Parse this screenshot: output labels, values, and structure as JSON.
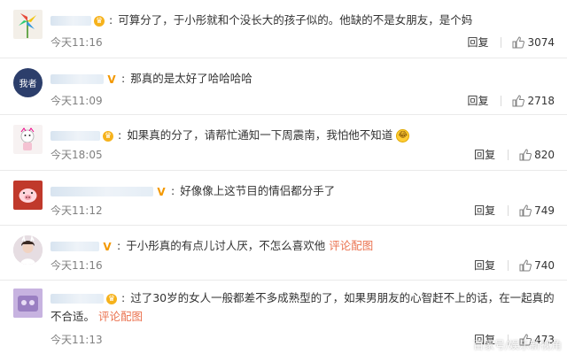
{
  "comments": [
    {
      "text": "可算分了，于小彤就和个没长大的孩子似的。他缺的不是女朋友，是个妈",
      "time": "今天11:16",
      "reply_label": "回复",
      "likes": "3074",
      "badge": "crown"
    },
    {
      "text": "那真的是太好了哈哈哈哈",
      "time": "今天11:09",
      "reply_label": "回复",
      "likes": "2718",
      "badge": "vip"
    },
    {
      "text": "如果真的分了，请帮忙通知一下周震南，我怕他不知道",
      "time": "今天18:05",
      "reply_label": "回复",
      "likes": "820",
      "badge": "crown"
    },
    {
      "text": "好像像上这节目的情侣都分手了",
      "time": "今天11:12",
      "reply_label": "回复",
      "likes": "749",
      "badge": "vip"
    },
    {
      "text": "于小彤真的有点儿讨人厌，不怎么喜欢他",
      "link": "评论配图",
      "time": "今天11:16",
      "reply_label": "回复",
      "likes": "740",
      "badge": "vip"
    },
    {
      "text": "过了30岁的女人一般都差不多成熟型的了，如果男朋友的心智赶不上的话，在一起真的不合适。",
      "link": "评论配图",
      "time": "今天11:13",
      "reply_label": "回复",
      "likes": "473",
      "badge": "crown"
    }
  ],
  "avatar_labels": {
    "c2": "我者"
  },
  "watermark": "百家号/娱乐新视角",
  "colors": {
    "link": "#eb7350",
    "time": "#808080",
    "vip": "#f39800"
  }
}
